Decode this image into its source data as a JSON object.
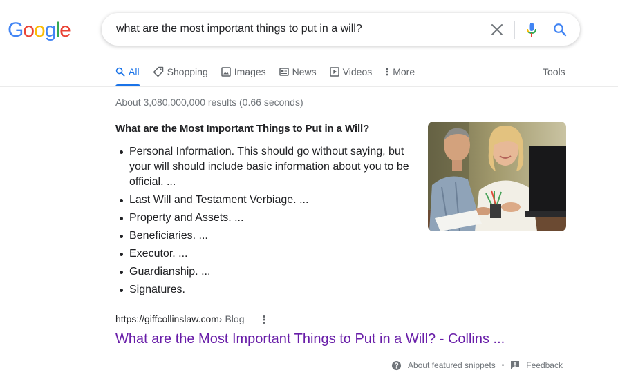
{
  "logo": {
    "letters": [
      "G",
      "o",
      "o",
      "g",
      "l",
      "e"
    ],
    "colors": [
      "#4285f4",
      "#ea4335",
      "#fbbc05",
      "#4285f4",
      "#34a853",
      "#ea4335"
    ]
  },
  "search": {
    "query": "what are the most important things to put in a will?"
  },
  "tabs": [
    {
      "label": "All",
      "icon": "search-icon",
      "active": true
    },
    {
      "label": "Shopping",
      "icon": "tag-icon"
    },
    {
      "label": "Images",
      "icon": "image-icon"
    },
    {
      "label": "News",
      "icon": "newspaper-icon"
    },
    {
      "label": "Videos",
      "icon": "play-icon"
    },
    {
      "label": "More",
      "icon": "more-vert-icon"
    }
  ],
  "tools_label": "Tools",
  "result_stats": "About 3,080,000,000 results (0.66 seconds)",
  "snippet": {
    "title": "What are the Most Important Things to Put in a Will?",
    "items": [
      "Personal Information. This should go without saying, but your will should include basic information about you to be official. ...",
      "Last Will and Testament Verbiage. ...",
      "Property and Assets. ...",
      "Beneficiaries. ...",
      "Executor. ...",
      "Guardianship. ...",
      "Signatures."
    ],
    "image_icon": "photo-couple-icon"
  },
  "result": {
    "url": "https://giffcollinslaw.com",
    "breadcrumb": " › Blog",
    "title": "What are the Most Important Things to Put in a Will? - Collins ..."
  },
  "footer": {
    "about_label": "About featured snippets",
    "separator": "•",
    "feedback_label": "Feedback"
  },
  "colors": {
    "accent": "#1a73e8",
    "visited_link": "#681da8",
    "muted": "#5f6368"
  }
}
